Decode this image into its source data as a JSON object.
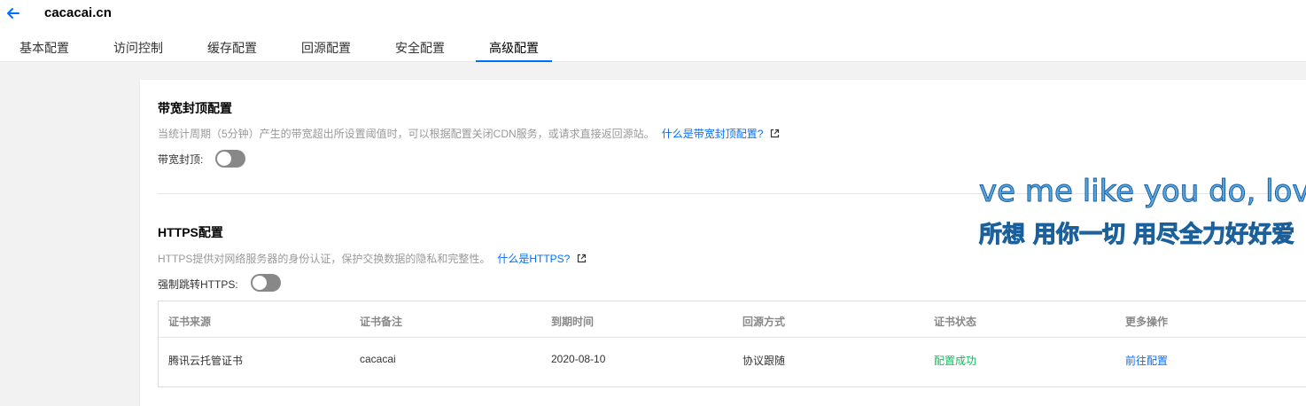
{
  "header": {
    "domain": "cacacai.cn",
    "back_icon": "arrow-left-icon"
  },
  "tabs": [
    {
      "label": "基本配置",
      "active": false
    },
    {
      "label": "访问控制",
      "active": false
    },
    {
      "label": "缓存配置",
      "active": false
    },
    {
      "label": "回源配置",
      "active": false
    },
    {
      "label": "安全配置",
      "active": false
    },
    {
      "label": "高级配置",
      "active": true
    }
  ],
  "bandwidth": {
    "title": "带宽封顶配置",
    "description": "当统计周期（5分钟）产生的带宽超出所设置阈值时，可以根据配置关闭CDN服务，或请求直接返回源站。",
    "help_link": "什么是带宽封顶配置?",
    "switch_label": "带宽封顶:",
    "enabled": false
  },
  "https": {
    "title": "HTTPS配置",
    "description": "HTTPS提供对网络服务器的身份认证，保护交换数据的隐私和完整性。",
    "help_link": "什么是HTTPS?",
    "switch_label": "强制跳转HTTPS:",
    "enabled": false,
    "table": {
      "columns": [
        "证书来源",
        "证书备注",
        "到期时间",
        "回源方式",
        "证书状态",
        "更多操作"
      ],
      "rows": [
        [
          "腾讯云托管证书",
          "cacacai",
          "2020-08-10",
          "协议跟随",
          "配置成功",
          "前往配置"
        ]
      ]
    }
  },
  "overlay": {
    "line1": "ve me like you do, love",
    "line2": "所想 用你一切 用尽全力好好爱"
  },
  "colors": {
    "accent": "#006eff",
    "success": "#0abf5b",
    "switch_off": "#888888"
  }
}
